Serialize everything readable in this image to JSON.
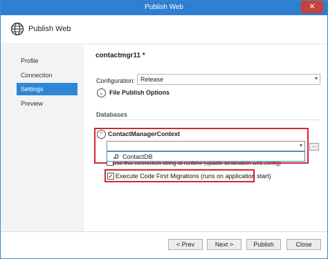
{
  "window": {
    "title": "Publish Web",
    "close_glyph": "✕"
  },
  "header": {
    "title": "Publish Web",
    "icon": "globe-icon"
  },
  "sidebar": {
    "items": [
      {
        "label": "Profile"
      },
      {
        "label": "Connection"
      },
      {
        "label": "Settings",
        "active": true
      },
      {
        "label": "Preview"
      }
    ]
  },
  "settings": {
    "profile_name": "contactmgr11 *",
    "configuration_label": "Configuration:",
    "configuration_value": "Release",
    "file_publish_options_label": "File Publish Options",
    "databases_heading": "Databases",
    "context_name": "ContactManagerContext",
    "connection_value": "",
    "browse_label": "...",
    "suggestion": "ContactDB",
    "runtime_checkbox_label": "Use this connection string at runtime (update destination web.config)",
    "migrations_label": "Execute Code First Migrations (runs on application start)",
    "migrations_checked": true
  },
  "footer": {
    "prev_label": "< Prev",
    "next_label": "Next >",
    "publish_label": "Publish",
    "close_label": "Close"
  },
  "colors": {
    "accent": "#2e7fd1",
    "highlight_border": "#d9232b",
    "selected_nav": "#2f86d6"
  }
}
